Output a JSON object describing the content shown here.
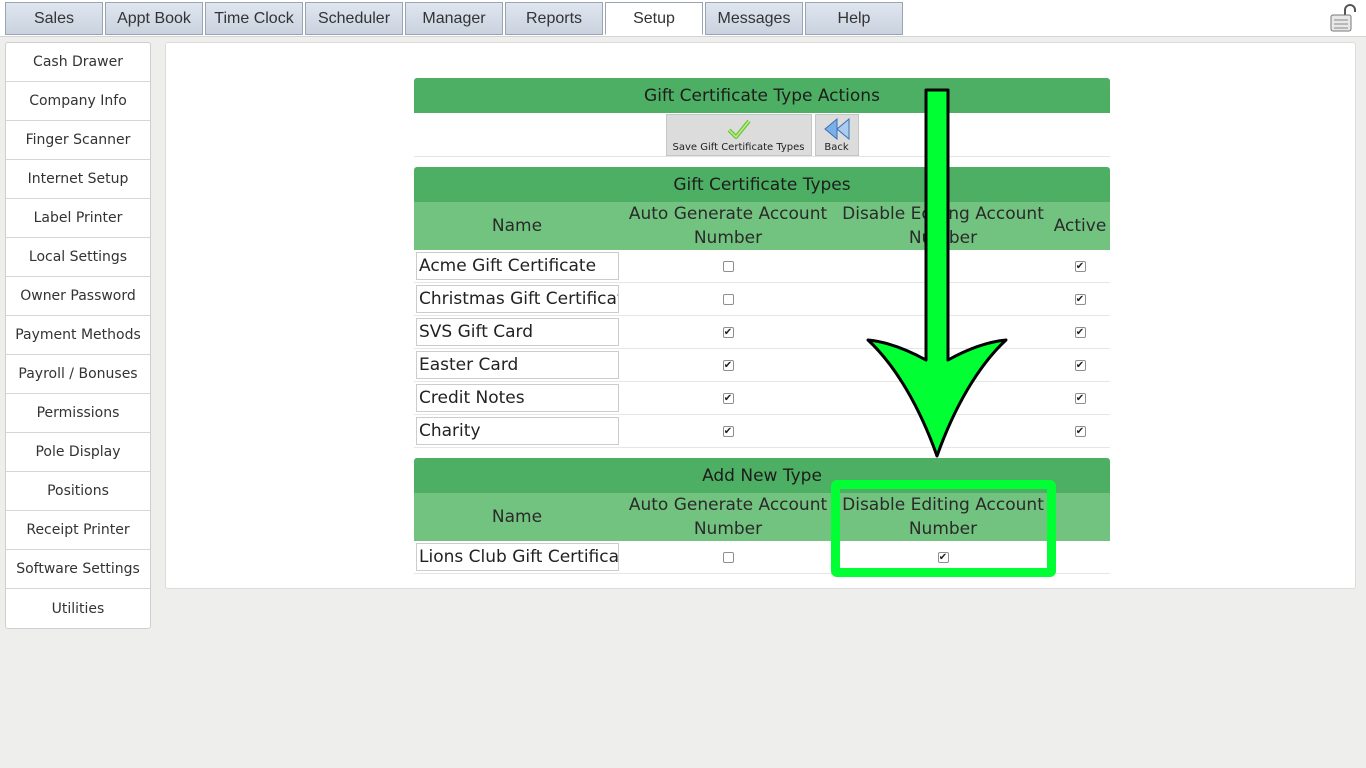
{
  "top_tabs": [
    "Sales",
    "Appt Book",
    "Time Clock",
    "Scheduler",
    "Manager",
    "Reports",
    "Setup",
    "Messages",
    "Help"
  ],
  "active_tab": "Setup",
  "sidebar": {
    "items": [
      {
        "label": "Cash Drawer"
      },
      {
        "label": "Company Info"
      },
      {
        "label": "Finger Scanner"
      },
      {
        "label": "Internet Setup"
      },
      {
        "label": "Label Printer"
      },
      {
        "label": "Local Settings"
      },
      {
        "label": "Owner Password"
      },
      {
        "label": "Payment Methods"
      },
      {
        "label": "Payroll / Bonuses"
      },
      {
        "label": "Permissions"
      },
      {
        "label": "Pole Display"
      },
      {
        "label": "Positions"
      },
      {
        "label": "Receipt Printer"
      },
      {
        "label": "Software Settings"
      },
      {
        "label": "Utilities"
      }
    ]
  },
  "actions": {
    "title": "Gift Certificate Type Actions",
    "save_label": "Save Gift Certificate Types",
    "back_label": "Back"
  },
  "types": {
    "title": "Gift Certificate Types",
    "headers": {
      "name": "Name",
      "auto": "Auto Generate Account Number",
      "disable": "Disable Editing Account Number",
      "active": "Active"
    },
    "rows": [
      {
        "name": "Acme Gift Certificate",
        "auto": false,
        "active": true
      },
      {
        "name": "Christmas Gift Certificate",
        "auto": false,
        "active": true
      },
      {
        "name": "SVS Gift Card",
        "auto": true,
        "active": true
      },
      {
        "name": "Easter Card",
        "auto": true,
        "active": true
      },
      {
        "name": "Credit Notes",
        "auto": true,
        "active": true
      },
      {
        "name": "Charity",
        "auto": true,
        "active": true
      }
    ]
  },
  "add_new": {
    "title": "Add New Type",
    "headers": {
      "name": "Name",
      "auto": "Auto Generate Account Number",
      "disable": "Disable Editing Account Number"
    },
    "row": {
      "name": "Lions Club Gift Certificate",
      "auto": false,
      "disable": true
    }
  },
  "colors": {
    "header_green": "#4caf63",
    "subheader_green": "#72c380",
    "annotation_green": "#00ff33"
  }
}
